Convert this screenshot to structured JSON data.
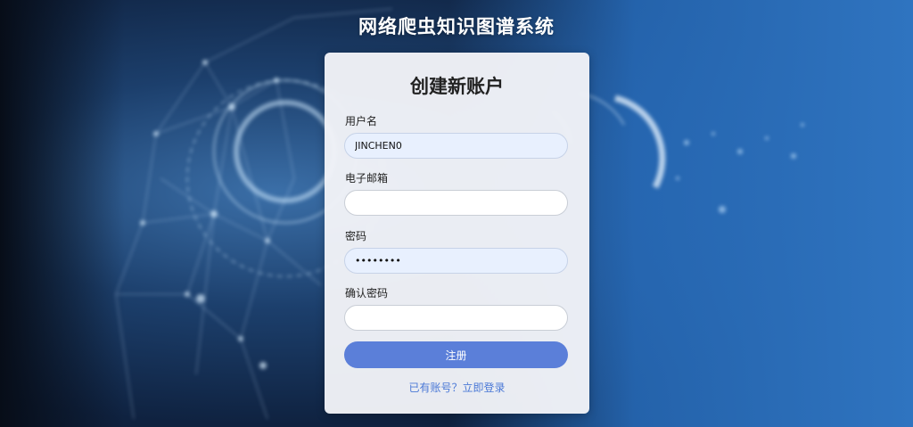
{
  "app_title": "网络爬虫知识图谱系统",
  "form": {
    "heading": "创建新账户",
    "username": {
      "label": "用户名",
      "value": "JINCHEN0"
    },
    "email": {
      "label": "电子邮箱",
      "value": ""
    },
    "password": {
      "label": "密码",
      "value": "••••••••"
    },
    "confirm_password": {
      "label": "确认密码",
      "value": ""
    },
    "submit_label": "注册",
    "login_link": "已有账号？立即登录"
  },
  "colors": {
    "accent": "#5b7fd9",
    "link": "#4a78d6",
    "autofill": "#e8f0fe"
  }
}
